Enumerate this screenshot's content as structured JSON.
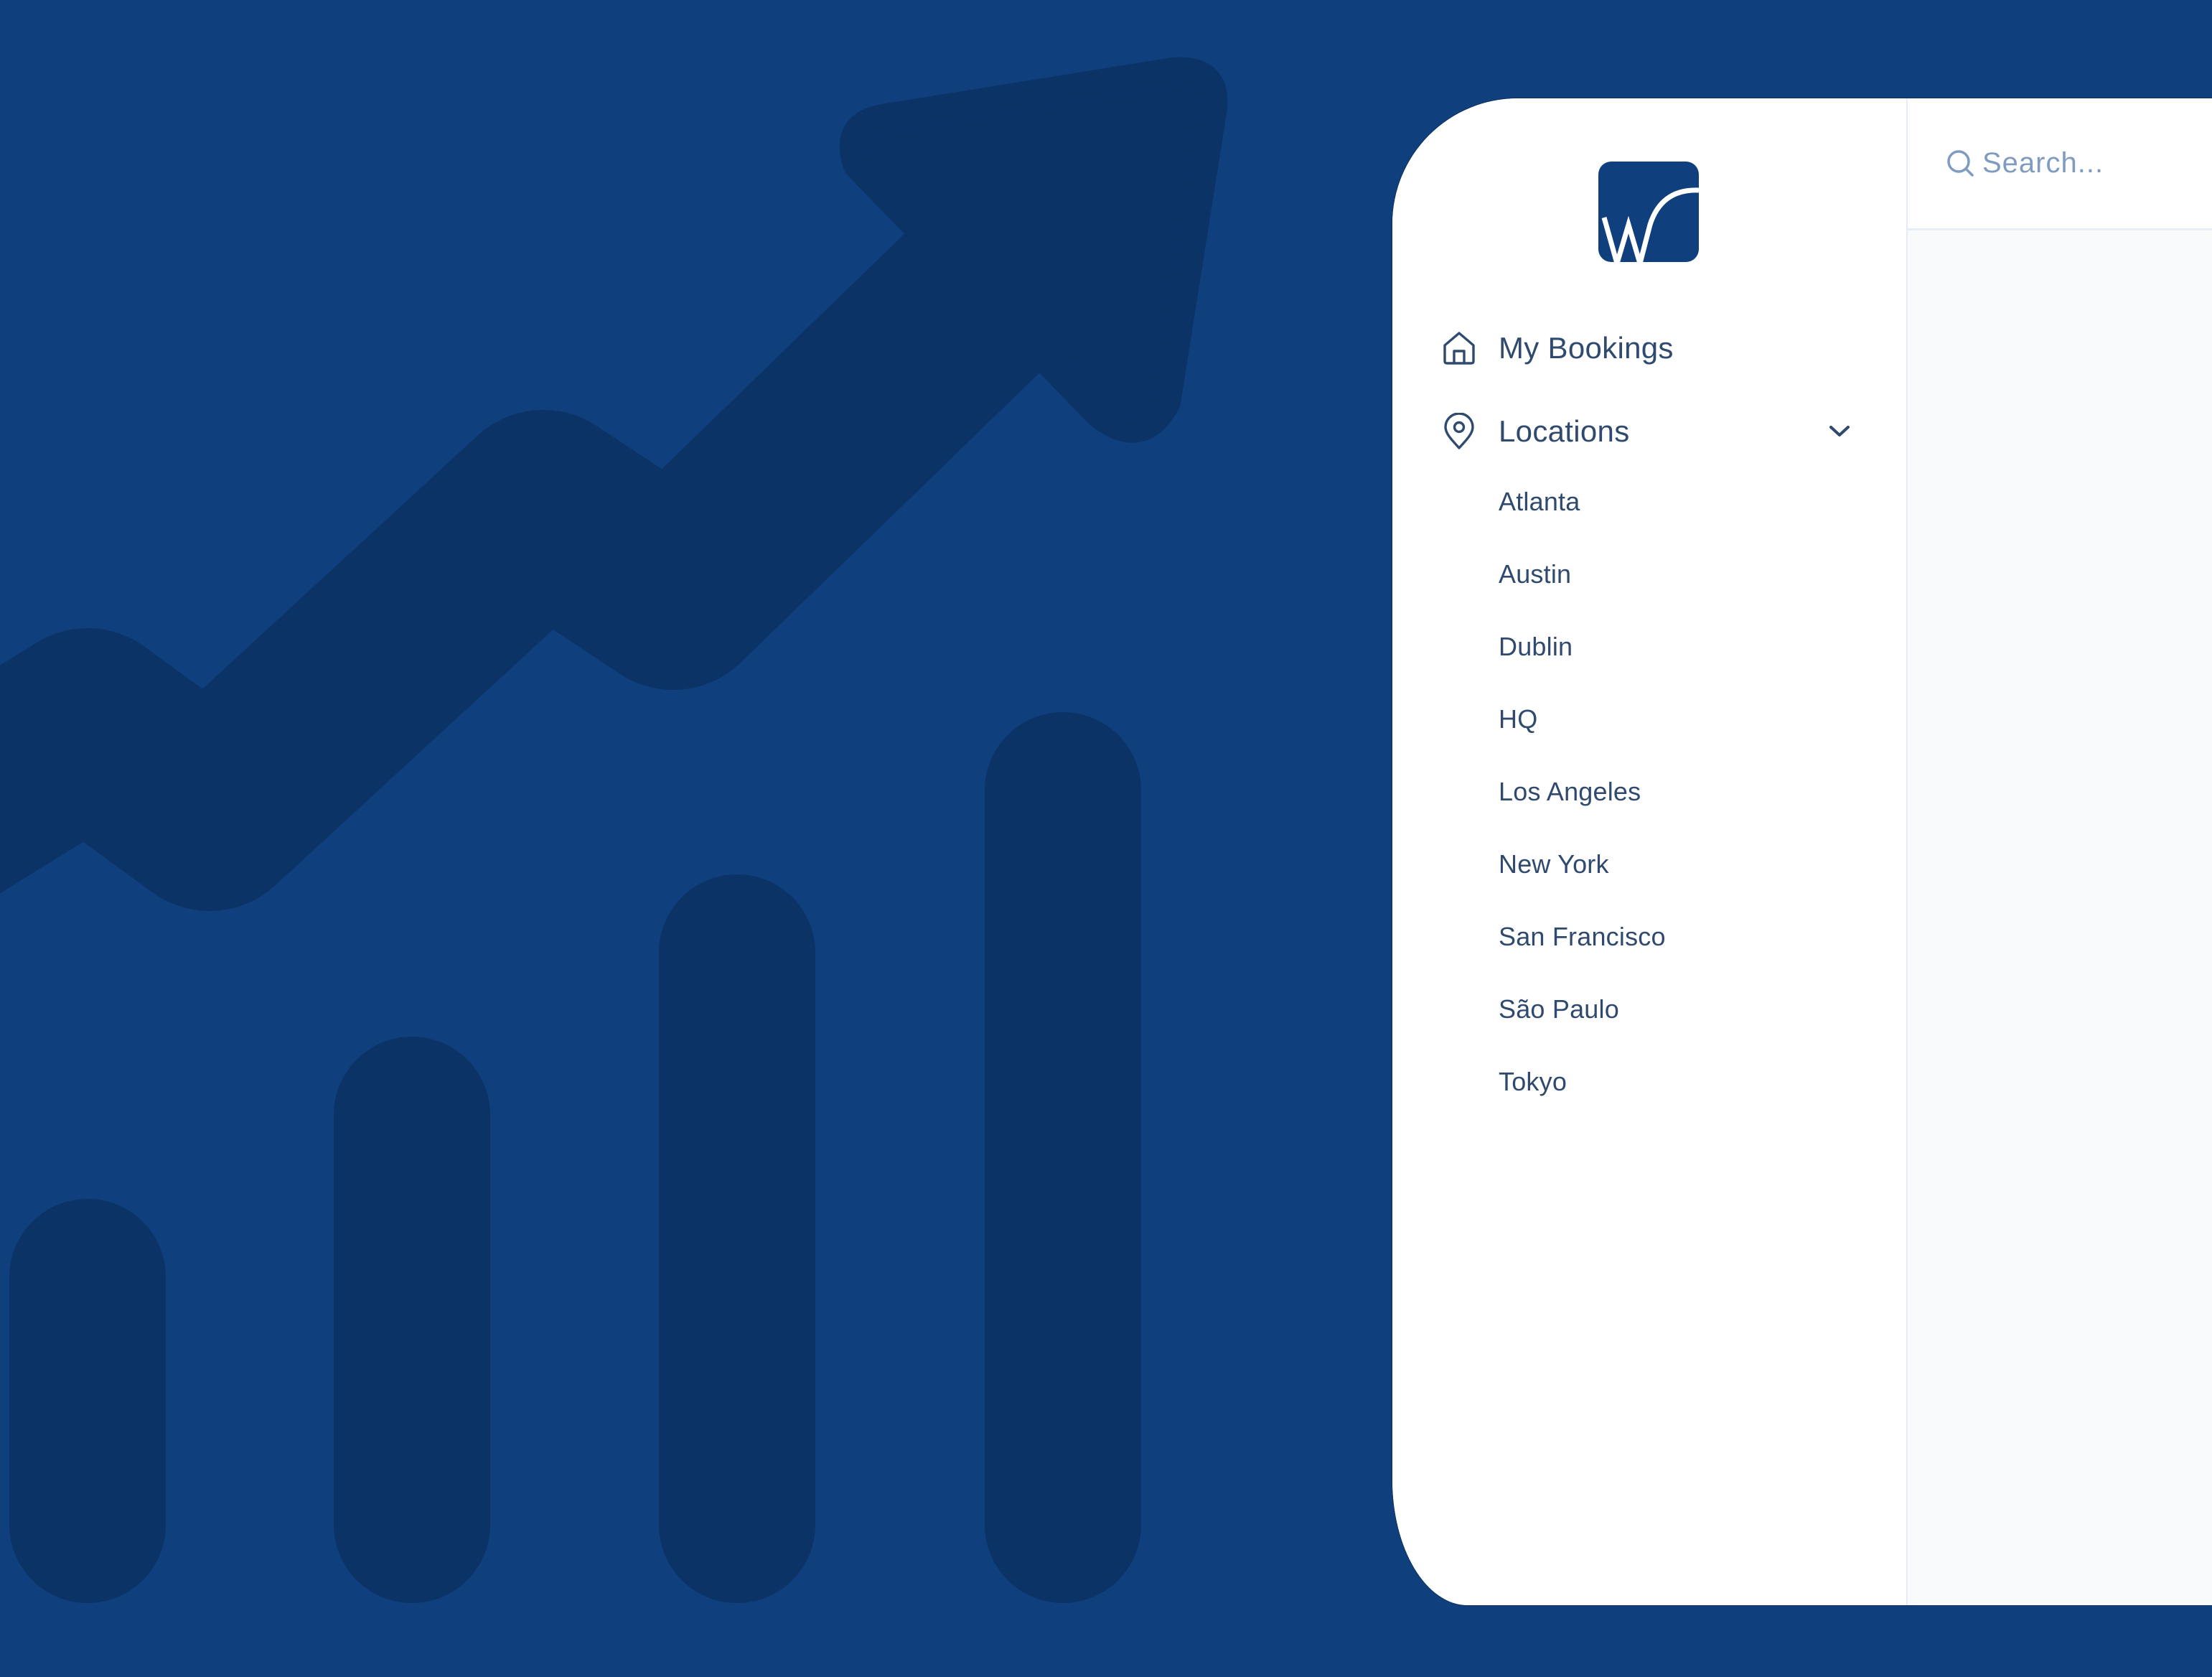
{
  "theme": {
    "background": "#0F3F7C",
    "background_art": "#0B3366",
    "brand": "#0F3F7C",
    "text": "#2F4A6E",
    "placeholder": "#7F9CC0",
    "content_bg": "#F8FAFC",
    "border": "#E6ECF4"
  },
  "background_art": {
    "description": "decorative rising trend arrow over four rounded bars",
    "icon": "trend-up-arrow",
    "bars": 4
  },
  "logo": {
    "icon": "w-brand-logo",
    "letter": "W"
  },
  "sidebar": {
    "items": [
      {
        "label": "My Bookings",
        "icon": "home-icon"
      },
      {
        "label": "Locations",
        "icon": "map-pin-icon",
        "expanded": true,
        "toggle_icon": "chevron-down-icon"
      }
    ],
    "locations": [
      "Atlanta",
      "Austin",
      "Dublin",
      "HQ",
      "Los Angeles",
      "New York",
      "San Francisco",
      "São Paulo",
      "Tokyo"
    ]
  },
  "header": {
    "search": {
      "placeholder": "Search...",
      "value": "",
      "icon": "search-icon"
    }
  }
}
